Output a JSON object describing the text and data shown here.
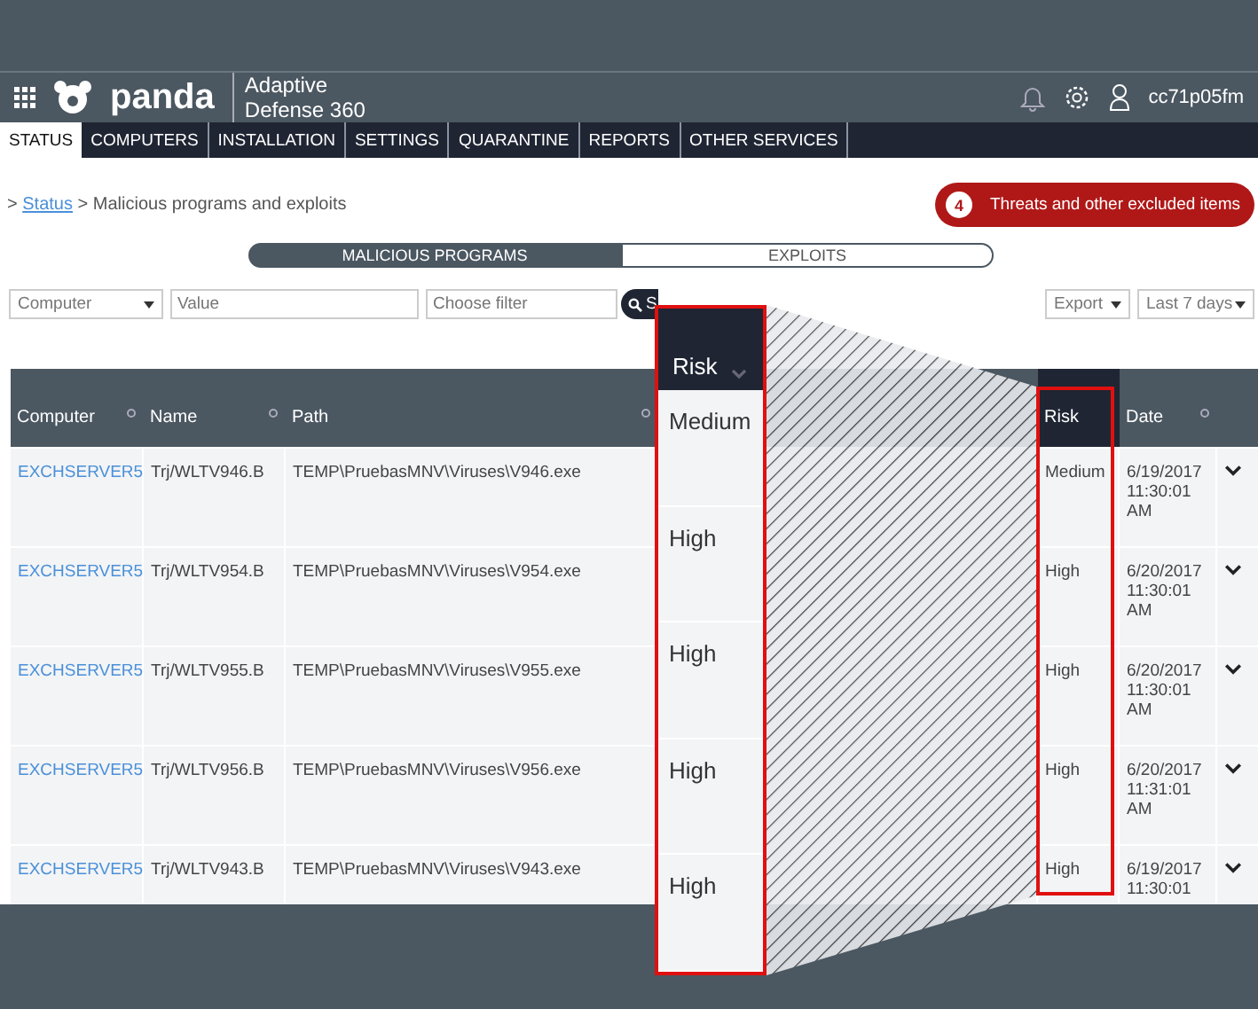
{
  "header": {
    "brand": "panda",
    "product": [
      "Adaptive",
      "Defense 360"
    ],
    "user": "cc71p05fm"
  },
  "nav": [
    {
      "label": "STATUS",
      "selected": true
    },
    {
      "label": "COMPUTERS",
      "selected": false
    },
    {
      "label": "INSTALLATION",
      "selected": false
    },
    {
      "label": "SETTINGS",
      "selected": false
    },
    {
      "label": "QUARANTINE",
      "selected": false
    },
    {
      "label": "REPORTS",
      "selected": false
    },
    {
      "label": "OTHER SERVICES",
      "selected": false
    }
  ],
  "breadcrumb": {
    "prefix": ">",
    "link": "Status",
    "separator": ">",
    "current": "Malicious programs and exploits"
  },
  "alert": {
    "count": "4",
    "label": "Threats and other excluded items"
  },
  "segments": [
    {
      "label": "MALICIOUS PROGRAMS",
      "selected": true
    },
    {
      "label": "EXPLOITS",
      "selected": false
    }
  ],
  "filters": {
    "column": "Computer",
    "value_placeholder": "Value",
    "filter_placeholder": "Choose filter",
    "search": "S",
    "export": "Export",
    "range": "Last 7 days"
  },
  "table": {
    "columns": [
      "Computer",
      "Name",
      "Path",
      "Risk",
      "Date"
    ],
    "rows": [
      {
        "computer": "EXCHSERVER5",
        "name": "Trj/WLTV946.B",
        "path": "TEMP\\PruebasMNV\\Viruses\\V946.exe",
        "risk": "Medium",
        "date": "6/19/2017 11:30:01 AM"
      },
      {
        "computer": "EXCHSERVER5",
        "name": "Trj/WLTV954.B",
        "path": "TEMP\\PruebasMNV\\Viruses\\V954.exe",
        "risk": "High",
        "date": "6/20/2017 11:30:01 AM"
      },
      {
        "computer": "EXCHSERVER5",
        "name": "Trj/WLTV955.B",
        "path": "TEMP\\PruebasMNV\\Viruses\\V955.exe",
        "risk": "High",
        "date": "6/20/2017 11:30:01 AM"
      },
      {
        "computer": "EXCHSERVER5",
        "name": "Trj/WLTV956.B",
        "path": "TEMP\\PruebasMNV\\Viruses\\V956.exe",
        "risk": "High",
        "date": "6/20/2017 11:31:01 AM"
      },
      {
        "computer": "EXCHSERVER5",
        "name": "Trj/WLTV943.B",
        "path": "TEMP\\PruebasMNV\\Viruses\\V943.exe",
        "risk": "High",
        "date": "6/19/2017 11:30:01"
      }
    ]
  },
  "callout": {
    "header": "Risk",
    "values": [
      "Medium",
      "High",
      "High",
      "High",
      "High"
    ]
  }
}
